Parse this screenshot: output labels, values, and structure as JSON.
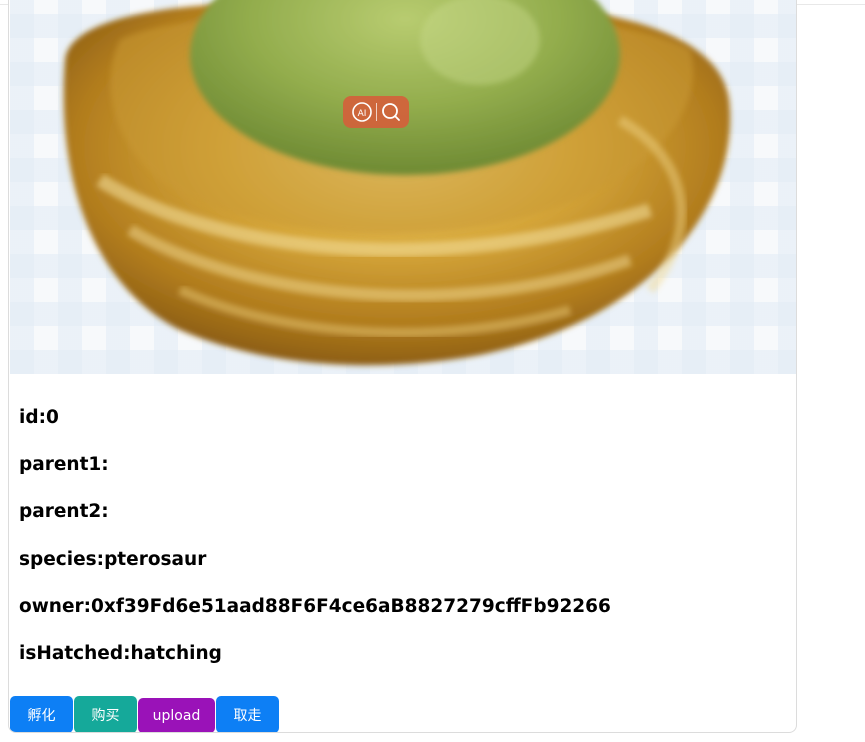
{
  "egg_card": {
    "image": {
      "alt": "egg-in-nest",
      "overlay_badge": {
        "icons": [
          "ai-icon",
          "magnifier-icon"
        ]
      }
    },
    "fields": {
      "id": "id:0",
      "parent1": "parent1:",
      "parent2": "parent2:",
      "species": "species:pterosaur",
      "owner": "owner:0xf39Fd6e51aad88F6F4ce6aB8827279cffFb92266",
      "is_hatched": "isHatched:hatching"
    },
    "buttons": {
      "hatch": "孵化",
      "buy": "购买",
      "upload": "upload",
      "take": "取走"
    }
  },
  "colors": {
    "hatch_button": "#0d7ff5",
    "buy_button": "#15a99a",
    "upload_button": "#9a12b8",
    "take_button": "#0d7ff5",
    "ai_badge": "#d65d3a"
  }
}
